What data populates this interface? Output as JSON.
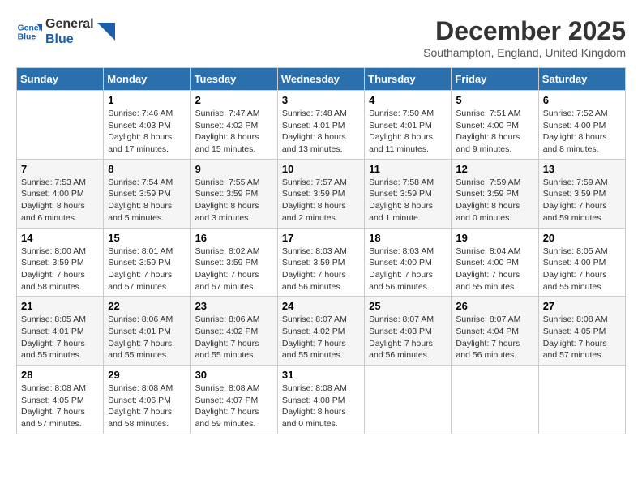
{
  "logo": {
    "line1": "General",
    "line2": "Blue"
  },
  "title": "December 2025",
  "location": "Southampton, England, United Kingdom",
  "headers": [
    "Sunday",
    "Monday",
    "Tuesday",
    "Wednesday",
    "Thursday",
    "Friday",
    "Saturday"
  ],
  "weeks": [
    [
      {
        "day": "",
        "info": ""
      },
      {
        "day": "1",
        "info": "Sunrise: 7:46 AM\nSunset: 4:03 PM\nDaylight: 8 hours\nand 17 minutes."
      },
      {
        "day": "2",
        "info": "Sunrise: 7:47 AM\nSunset: 4:02 PM\nDaylight: 8 hours\nand 15 minutes."
      },
      {
        "day": "3",
        "info": "Sunrise: 7:48 AM\nSunset: 4:01 PM\nDaylight: 8 hours\nand 13 minutes."
      },
      {
        "day": "4",
        "info": "Sunrise: 7:50 AM\nSunset: 4:01 PM\nDaylight: 8 hours\nand 11 minutes."
      },
      {
        "day": "5",
        "info": "Sunrise: 7:51 AM\nSunset: 4:00 PM\nDaylight: 8 hours\nand 9 minutes."
      },
      {
        "day": "6",
        "info": "Sunrise: 7:52 AM\nSunset: 4:00 PM\nDaylight: 8 hours\nand 8 minutes."
      }
    ],
    [
      {
        "day": "7",
        "info": "Sunrise: 7:53 AM\nSunset: 4:00 PM\nDaylight: 8 hours\nand 6 minutes."
      },
      {
        "day": "8",
        "info": "Sunrise: 7:54 AM\nSunset: 3:59 PM\nDaylight: 8 hours\nand 5 minutes."
      },
      {
        "day": "9",
        "info": "Sunrise: 7:55 AM\nSunset: 3:59 PM\nDaylight: 8 hours\nand 3 minutes."
      },
      {
        "day": "10",
        "info": "Sunrise: 7:57 AM\nSunset: 3:59 PM\nDaylight: 8 hours\nand 2 minutes."
      },
      {
        "day": "11",
        "info": "Sunrise: 7:58 AM\nSunset: 3:59 PM\nDaylight: 8 hours\nand 1 minute."
      },
      {
        "day": "12",
        "info": "Sunrise: 7:59 AM\nSunset: 3:59 PM\nDaylight: 8 hours\nand 0 minutes."
      },
      {
        "day": "13",
        "info": "Sunrise: 7:59 AM\nSunset: 3:59 PM\nDaylight: 7 hours\nand 59 minutes."
      }
    ],
    [
      {
        "day": "14",
        "info": "Sunrise: 8:00 AM\nSunset: 3:59 PM\nDaylight: 7 hours\nand 58 minutes."
      },
      {
        "day": "15",
        "info": "Sunrise: 8:01 AM\nSunset: 3:59 PM\nDaylight: 7 hours\nand 57 minutes."
      },
      {
        "day": "16",
        "info": "Sunrise: 8:02 AM\nSunset: 3:59 PM\nDaylight: 7 hours\nand 57 minutes."
      },
      {
        "day": "17",
        "info": "Sunrise: 8:03 AM\nSunset: 3:59 PM\nDaylight: 7 hours\nand 56 minutes."
      },
      {
        "day": "18",
        "info": "Sunrise: 8:03 AM\nSunset: 4:00 PM\nDaylight: 7 hours\nand 56 minutes."
      },
      {
        "day": "19",
        "info": "Sunrise: 8:04 AM\nSunset: 4:00 PM\nDaylight: 7 hours\nand 55 minutes."
      },
      {
        "day": "20",
        "info": "Sunrise: 8:05 AM\nSunset: 4:00 PM\nDaylight: 7 hours\nand 55 minutes."
      }
    ],
    [
      {
        "day": "21",
        "info": "Sunrise: 8:05 AM\nSunset: 4:01 PM\nDaylight: 7 hours\nand 55 minutes."
      },
      {
        "day": "22",
        "info": "Sunrise: 8:06 AM\nSunset: 4:01 PM\nDaylight: 7 hours\nand 55 minutes."
      },
      {
        "day": "23",
        "info": "Sunrise: 8:06 AM\nSunset: 4:02 PM\nDaylight: 7 hours\nand 55 minutes."
      },
      {
        "day": "24",
        "info": "Sunrise: 8:07 AM\nSunset: 4:02 PM\nDaylight: 7 hours\nand 55 minutes."
      },
      {
        "day": "25",
        "info": "Sunrise: 8:07 AM\nSunset: 4:03 PM\nDaylight: 7 hours\nand 56 minutes."
      },
      {
        "day": "26",
        "info": "Sunrise: 8:07 AM\nSunset: 4:04 PM\nDaylight: 7 hours\nand 56 minutes."
      },
      {
        "day": "27",
        "info": "Sunrise: 8:08 AM\nSunset: 4:05 PM\nDaylight: 7 hours\nand 57 minutes."
      }
    ],
    [
      {
        "day": "28",
        "info": "Sunrise: 8:08 AM\nSunset: 4:05 PM\nDaylight: 7 hours\nand 57 minutes."
      },
      {
        "day": "29",
        "info": "Sunrise: 8:08 AM\nSunset: 4:06 PM\nDaylight: 7 hours\nand 58 minutes."
      },
      {
        "day": "30",
        "info": "Sunrise: 8:08 AM\nSunset: 4:07 PM\nDaylight: 7 hours\nand 59 minutes."
      },
      {
        "day": "31",
        "info": "Sunrise: 8:08 AM\nSunset: 4:08 PM\nDaylight: 8 hours\nand 0 minutes."
      },
      {
        "day": "",
        "info": ""
      },
      {
        "day": "",
        "info": ""
      },
      {
        "day": "",
        "info": ""
      }
    ]
  ]
}
